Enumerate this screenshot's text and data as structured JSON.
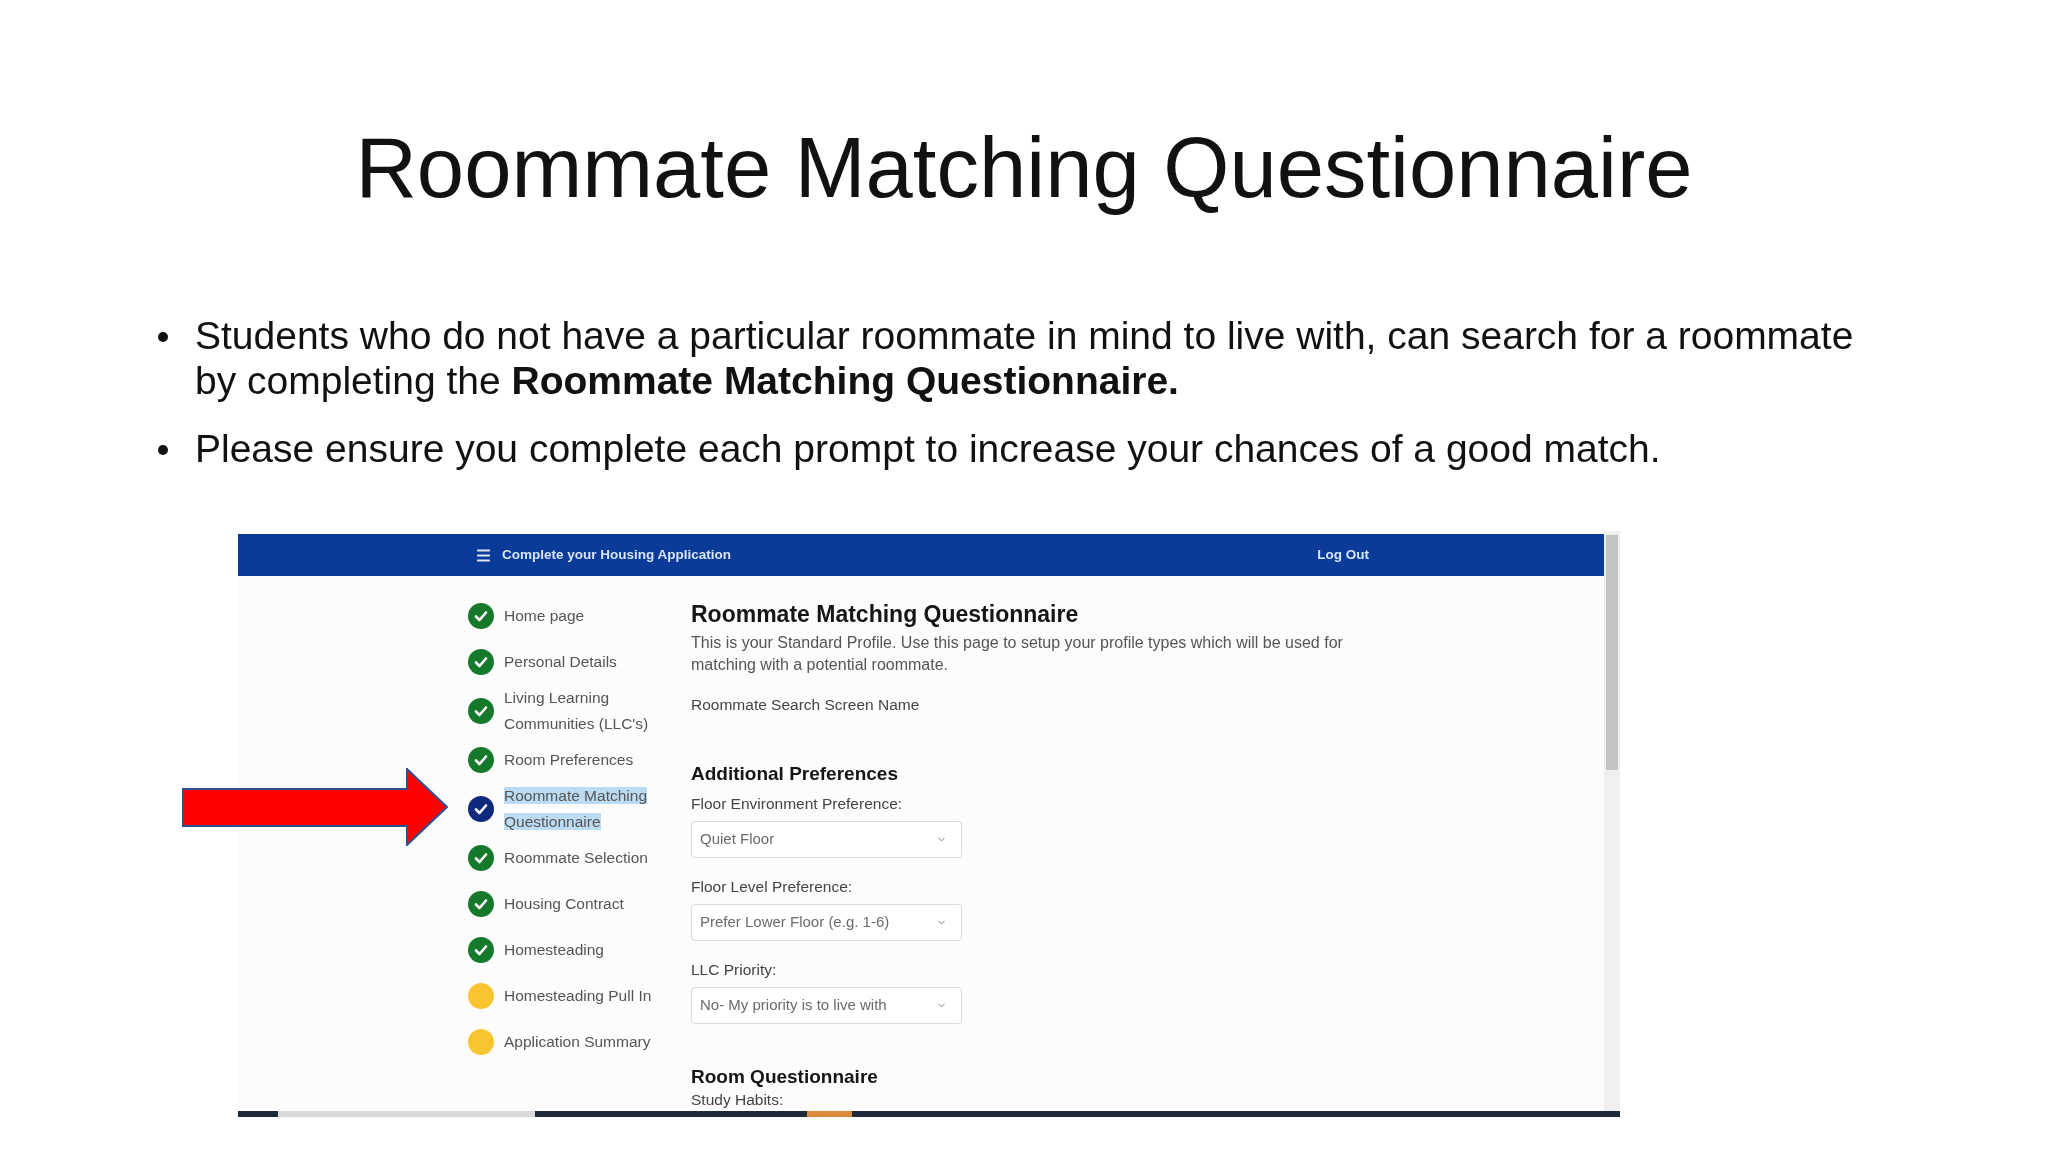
{
  "slide": {
    "title": "Roommate Matching Questionnaire",
    "bullets": [
      "Students who do not have a particular roommate in mind to live with, can search for a roommate by completing the **Roommate Matching Questionnaire.**",
      "Please ensure you complete each prompt to increase your chances of a good match."
    ]
  },
  "screenshot": {
    "header": {
      "title": "Complete your Housing Application",
      "logout": "Log Out"
    },
    "steps": [
      {
        "label": "Home page",
        "done": true,
        "selected": false,
        "highlighted": false
      },
      {
        "label": "Personal Details",
        "done": true,
        "selected": false,
        "highlighted": false
      },
      {
        "label": "Living Learning Communities (LLC's)",
        "done": true,
        "selected": false,
        "highlighted": false
      },
      {
        "label": "Room Preferences",
        "done": true,
        "selected": false,
        "highlighted": false
      },
      {
        "label": "Roommate Matching Questionnaire",
        "done": true,
        "selected": true,
        "highlighted": true
      },
      {
        "label": "Roommate Selection",
        "done": true,
        "selected": false,
        "highlighted": false
      },
      {
        "label": "Housing Contract",
        "done": true,
        "selected": false,
        "highlighted": false
      },
      {
        "label": "Homesteading",
        "done": true,
        "selected": false,
        "highlighted": false
      },
      {
        "label": "Homesteading Pull In",
        "done": false,
        "selected": false,
        "highlighted": false
      },
      {
        "label": "Application Summary",
        "done": false,
        "selected": false,
        "highlighted": false
      }
    ],
    "page": {
      "heading": "Roommate Matching Questionnaire",
      "description": "This is your Standard Profile. Use this page to setup your profile types which will be used for matching with a potential roommate.",
      "screen_name_label": "Roommate Search Screen Name",
      "sections": [
        {
          "heading": "Additional Preferences",
          "fields": [
            {
              "kind": "select",
              "label": "Floor Environment Preference:",
              "value": "Quiet Floor"
            },
            {
              "kind": "select",
              "label": "Floor Level Preference:",
              "value": "Prefer Lower Floor (e.g. 1-6)"
            },
            {
              "kind": "select",
              "label": "LLC Priority:",
              "value": "No- My priority is to live with"
            }
          ]
        },
        {
          "heading": "Room Questionnaire",
          "fields": [
            {
              "kind": "label",
              "label": "Study Habits:"
            }
          ]
        }
      ]
    }
  }
}
